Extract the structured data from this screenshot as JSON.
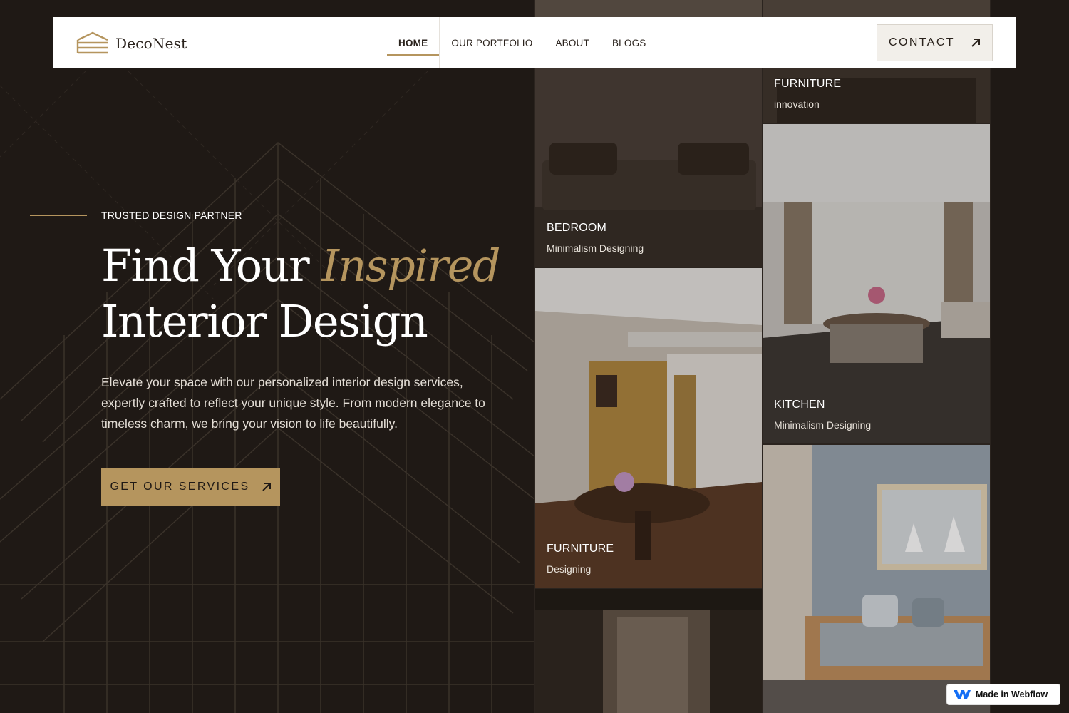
{
  "brand": {
    "name": "DecoNest",
    "logo_icon": "stacked-roof-logo-icon"
  },
  "nav": {
    "items": [
      {
        "label": "HOME",
        "active": true
      },
      {
        "label": "OUR PORTFOLIO",
        "active": false
      },
      {
        "label": "ABOUT",
        "active": false
      },
      {
        "label": "BLOGS",
        "active": false
      }
    ],
    "contact_label": "CONTACT",
    "contact_icon": "arrow-up-right-icon"
  },
  "hero": {
    "eyebrow": "TRUSTED DESIGN PARTNER",
    "headline_part1": "Find Your ",
    "headline_accent": "Inspired",
    "headline_part2": "Interior Design",
    "description": "Elevate your space with our personalized interior design services, expertly crafted to reflect your unique style. From modern elegance to timeless charm, we bring your vision to life beautifully.",
    "cta_label": "GET OUR SERVICES",
    "cta_icon": "arrow-up-right-icon"
  },
  "gallery": {
    "cards": [
      {
        "title": "FURNITURE",
        "subtitle": "innovation"
      },
      {
        "title": "BEDROOM",
        "subtitle": "Minimalism Designing"
      },
      {
        "title": "KITCHEN",
        "subtitle": "Minimalism Designing"
      },
      {
        "title": "FURNITURE",
        "subtitle": "Designing"
      }
    ]
  },
  "badge": {
    "label": "Made in Webflow",
    "icon": "webflow-logo-icon"
  },
  "colors": {
    "background": "#1f1915",
    "accent": "#b5955e",
    "header": "#ffffff",
    "contact_button": "#f2efea"
  }
}
